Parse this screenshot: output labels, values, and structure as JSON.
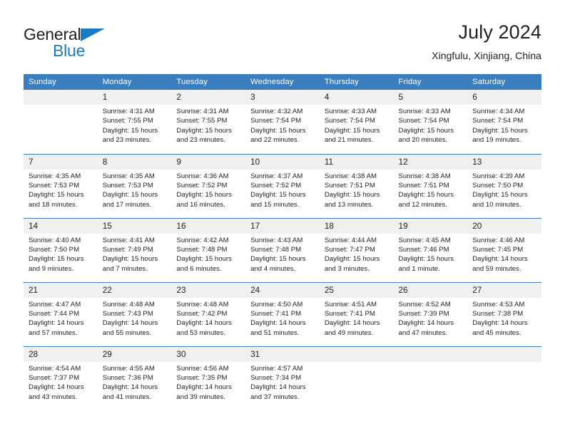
{
  "brand": {
    "name_part1": "General",
    "name_part2": "Blue",
    "flag_icon": "blue-triangle-icon",
    "accent_color": "#1a7ac4"
  },
  "header": {
    "title": "July 2024",
    "subtitle": "Xingfulu, Xinjiang, China"
  },
  "calendar": {
    "header_bg": "#3a7ebf",
    "daynum_bg": "#f0f0f0",
    "weekday_names": [
      "Sunday",
      "Monday",
      "Tuesday",
      "Wednesday",
      "Thursday",
      "Friday",
      "Saturday"
    ],
    "weeks": [
      [
        {
          "day": "",
          "sunrise": "",
          "sunset": "",
          "daylight1": "",
          "daylight2": ""
        },
        {
          "day": "1",
          "sunrise": "Sunrise: 4:31 AM",
          "sunset": "Sunset: 7:55 PM",
          "daylight1": "Daylight: 15 hours",
          "daylight2": "and 23 minutes."
        },
        {
          "day": "2",
          "sunrise": "Sunrise: 4:31 AM",
          "sunset": "Sunset: 7:55 PM",
          "daylight1": "Daylight: 15 hours",
          "daylight2": "and 23 minutes."
        },
        {
          "day": "3",
          "sunrise": "Sunrise: 4:32 AM",
          "sunset": "Sunset: 7:54 PM",
          "daylight1": "Daylight: 15 hours",
          "daylight2": "and 22 minutes."
        },
        {
          "day": "4",
          "sunrise": "Sunrise: 4:33 AM",
          "sunset": "Sunset: 7:54 PM",
          "daylight1": "Daylight: 15 hours",
          "daylight2": "and 21 minutes."
        },
        {
          "day": "5",
          "sunrise": "Sunrise: 4:33 AM",
          "sunset": "Sunset: 7:54 PM",
          "daylight1": "Daylight: 15 hours",
          "daylight2": "and 20 minutes."
        },
        {
          "day": "6",
          "sunrise": "Sunrise: 4:34 AM",
          "sunset": "Sunset: 7:54 PM",
          "daylight1": "Daylight: 15 hours",
          "daylight2": "and 19 minutes."
        }
      ],
      [
        {
          "day": "7",
          "sunrise": "Sunrise: 4:35 AM",
          "sunset": "Sunset: 7:53 PM",
          "daylight1": "Daylight: 15 hours",
          "daylight2": "and 18 minutes."
        },
        {
          "day": "8",
          "sunrise": "Sunrise: 4:35 AM",
          "sunset": "Sunset: 7:53 PM",
          "daylight1": "Daylight: 15 hours",
          "daylight2": "and 17 minutes."
        },
        {
          "day": "9",
          "sunrise": "Sunrise: 4:36 AM",
          "sunset": "Sunset: 7:52 PM",
          "daylight1": "Daylight: 15 hours",
          "daylight2": "and 16 minutes."
        },
        {
          "day": "10",
          "sunrise": "Sunrise: 4:37 AM",
          "sunset": "Sunset: 7:52 PM",
          "daylight1": "Daylight: 15 hours",
          "daylight2": "and 15 minutes."
        },
        {
          "day": "11",
          "sunrise": "Sunrise: 4:38 AM",
          "sunset": "Sunset: 7:51 PM",
          "daylight1": "Daylight: 15 hours",
          "daylight2": "and 13 minutes."
        },
        {
          "day": "12",
          "sunrise": "Sunrise: 4:38 AM",
          "sunset": "Sunset: 7:51 PM",
          "daylight1": "Daylight: 15 hours",
          "daylight2": "and 12 minutes."
        },
        {
          "day": "13",
          "sunrise": "Sunrise: 4:39 AM",
          "sunset": "Sunset: 7:50 PM",
          "daylight1": "Daylight: 15 hours",
          "daylight2": "and 10 minutes."
        }
      ],
      [
        {
          "day": "14",
          "sunrise": "Sunrise: 4:40 AM",
          "sunset": "Sunset: 7:50 PM",
          "daylight1": "Daylight: 15 hours",
          "daylight2": "and 9 minutes."
        },
        {
          "day": "15",
          "sunrise": "Sunrise: 4:41 AM",
          "sunset": "Sunset: 7:49 PM",
          "daylight1": "Daylight: 15 hours",
          "daylight2": "and 7 minutes."
        },
        {
          "day": "16",
          "sunrise": "Sunrise: 4:42 AM",
          "sunset": "Sunset: 7:48 PM",
          "daylight1": "Daylight: 15 hours",
          "daylight2": "and 6 minutes."
        },
        {
          "day": "17",
          "sunrise": "Sunrise: 4:43 AM",
          "sunset": "Sunset: 7:48 PM",
          "daylight1": "Daylight: 15 hours",
          "daylight2": "and 4 minutes."
        },
        {
          "day": "18",
          "sunrise": "Sunrise: 4:44 AM",
          "sunset": "Sunset: 7:47 PM",
          "daylight1": "Daylight: 15 hours",
          "daylight2": "and 3 minutes."
        },
        {
          "day": "19",
          "sunrise": "Sunrise: 4:45 AM",
          "sunset": "Sunset: 7:46 PM",
          "daylight1": "Daylight: 15 hours",
          "daylight2": "and 1 minute."
        },
        {
          "day": "20",
          "sunrise": "Sunrise: 4:46 AM",
          "sunset": "Sunset: 7:45 PM",
          "daylight1": "Daylight: 14 hours",
          "daylight2": "and 59 minutes."
        }
      ],
      [
        {
          "day": "21",
          "sunrise": "Sunrise: 4:47 AM",
          "sunset": "Sunset: 7:44 PM",
          "daylight1": "Daylight: 14 hours",
          "daylight2": "and 57 minutes."
        },
        {
          "day": "22",
          "sunrise": "Sunrise: 4:48 AM",
          "sunset": "Sunset: 7:43 PM",
          "daylight1": "Daylight: 14 hours",
          "daylight2": "and 55 minutes."
        },
        {
          "day": "23",
          "sunrise": "Sunrise: 4:48 AM",
          "sunset": "Sunset: 7:42 PM",
          "daylight1": "Daylight: 14 hours",
          "daylight2": "and 53 minutes."
        },
        {
          "day": "24",
          "sunrise": "Sunrise: 4:50 AM",
          "sunset": "Sunset: 7:41 PM",
          "daylight1": "Daylight: 14 hours",
          "daylight2": "and 51 minutes."
        },
        {
          "day": "25",
          "sunrise": "Sunrise: 4:51 AM",
          "sunset": "Sunset: 7:41 PM",
          "daylight1": "Daylight: 14 hours",
          "daylight2": "and 49 minutes."
        },
        {
          "day": "26",
          "sunrise": "Sunrise: 4:52 AM",
          "sunset": "Sunset: 7:39 PM",
          "daylight1": "Daylight: 14 hours",
          "daylight2": "and 47 minutes."
        },
        {
          "day": "27",
          "sunrise": "Sunrise: 4:53 AM",
          "sunset": "Sunset: 7:38 PM",
          "daylight1": "Daylight: 14 hours",
          "daylight2": "and 45 minutes."
        }
      ],
      [
        {
          "day": "28",
          "sunrise": "Sunrise: 4:54 AM",
          "sunset": "Sunset: 7:37 PM",
          "daylight1": "Daylight: 14 hours",
          "daylight2": "and 43 minutes."
        },
        {
          "day": "29",
          "sunrise": "Sunrise: 4:55 AM",
          "sunset": "Sunset: 7:36 PM",
          "daylight1": "Daylight: 14 hours",
          "daylight2": "and 41 minutes."
        },
        {
          "day": "30",
          "sunrise": "Sunrise: 4:56 AM",
          "sunset": "Sunset: 7:35 PM",
          "daylight1": "Daylight: 14 hours",
          "daylight2": "and 39 minutes."
        },
        {
          "day": "31",
          "sunrise": "Sunrise: 4:57 AM",
          "sunset": "Sunset: 7:34 PM",
          "daylight1": "Daylight: 14 hours",
          "daylight2": "and 37 minutes."
        },
        {
          "day": "",
          "sunrise": "",
          "sunset": "",
          "daylight1": "",
          "daylight2": ""
        },
        {
          "day": "",
          "sunrise": "",
          "sunset": "",
          "daylight1": "",
          "daylight2": ""
        },
        {
          "day": "",
          "sunrise": "",
          "sunset": "",
          "daylight1": "",
          "daylight2": ""
        }
      ]
    ]
  }
}
